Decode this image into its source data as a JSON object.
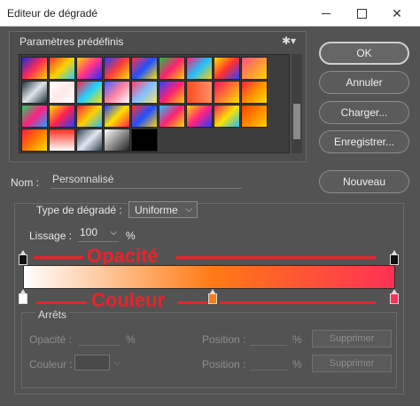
{
  "window": {
    "title": "Editeur de dégradé"
  },
  "presets": {
    "label": "Paramètres prédéfinis",
    "swatches": [
      "linear-gradient(135deg,#1c2bd4,#ff2a55,#ffd400)",
      "linear-gradient(135deg,#ff3232,#ffd200,#22d0ff)",
      "linear-gradient(135deg,#ffd200,#ff3090,#2030ff)",
      "linear-gradient(135deg,#2040ff,#ff3a3a,#ffe000)",
      "linear-gradient(135deg,#ff3040,#2050ff,#ffe000)",
      "linear-gradient(135deg,#20c040,#ff2070,#ffd000)",
      "linear-gradient(135deg,#ff2070,#20c0ff,#ffd000)",
      "linear-gradient(135deg,#ffe000,#ff3030,#3040ff)",
      "linear-gradient(135deg,#ff5080,#ffd200)",
      "linear-gradient(135deg,#20303a,#dfe6ea,#20303a)",
      "linear-gradient(135deg,#ffffff,#ffe8e8,#ffffff)",
      "linear-gradient(135deg,#ff2050,#20d0ff,#ffe000)",
      "linear-gradient(135deg,#4060ff,#ff80a0,#ffffff)",
      "linear-gradient(135deg,#ff4070,#80c0ff,#ffe060)",
      "linear-gradient(135deg,#3040ff,#ff2070,#ffd000)",
      "linear-gradient(90deg,#ff4b1f,#ff9068)",
      "linear-gradient(135deg,#ff1060,#ffe000)",
      "linear-gradient(135deg,#ff2040,#ff9000,#ffe000)",
      "linear-gradient(135deg,#20d060,#ff2080,#20a0ff)",
      "linear-gradient(135deg,#ffe000,#ff2050,#2040ff)",
      "linear-gradient(135deg,#ff2040,#ffd000,#20c0ff)",
      "linear-gradient(135deg,#2040ff,#ffe000,#ff2050)",
      "linear-gradient(135deg,#ff3030,#2050ff,#ffd000)",
      "linear-gradient(135deg,#20c0ff,#ff2070,#ffe000)",
      "linear-gradient(135deg,#ffd000,#ff2080,#2040ff)",
      "linear-gradient(135deg,#ff2060,#ffe000,#20c0ff)",
      "linear-gradient(135deg,#ff4000,#ffd000)",
      "linear-gradient(135deg,#ff1a40,#ff7a00,#ffe000)",
      "linear-gradient(180deg,#ff3020,#ffffff)",
      "linear-gradient(135deg,#304050,#e0e8f0,#304050)",
      "linear-gradient(135deg,#ffffff,#202020)",
      "linear-gradient(135deg,#000000,#000000)"
    ]
  },
  "buttons": {
    "ok": "OK",
    "cancel": "Annuler",
    "load": "Charger...",
    "save": "Enregistrer...",
    "new": "Nouveau"
  },
  "name": {
    "label": "Nom :",
    "value": "Personnalisé"
  },
  "gradient": {
    "type_label": "Type de dégradé :",
    "type_value": "Uniforme",
    "smooth_label": "Lissage :",
    "smooth_value": "100",
    "smooth_unit": "%",
    "colors": [
      "#ffffff",
      "#ff7a14",
      "#ff3055"
    ],
    "color_stop_midpoint": 0.51
  },
  "annotations": {
    "opacity": "Opacité",
    "color": "Couleur"
  },
  "stops": {
    "label": "Arrêts",
    "opacity_label": "Opacité :",
    "opacity_unit": "%",
    "position_label": "Position :",
    "position_unit": "%",
    "delete_label": "Supprimer",
    "color_label": "Couleur :"
  }
}
